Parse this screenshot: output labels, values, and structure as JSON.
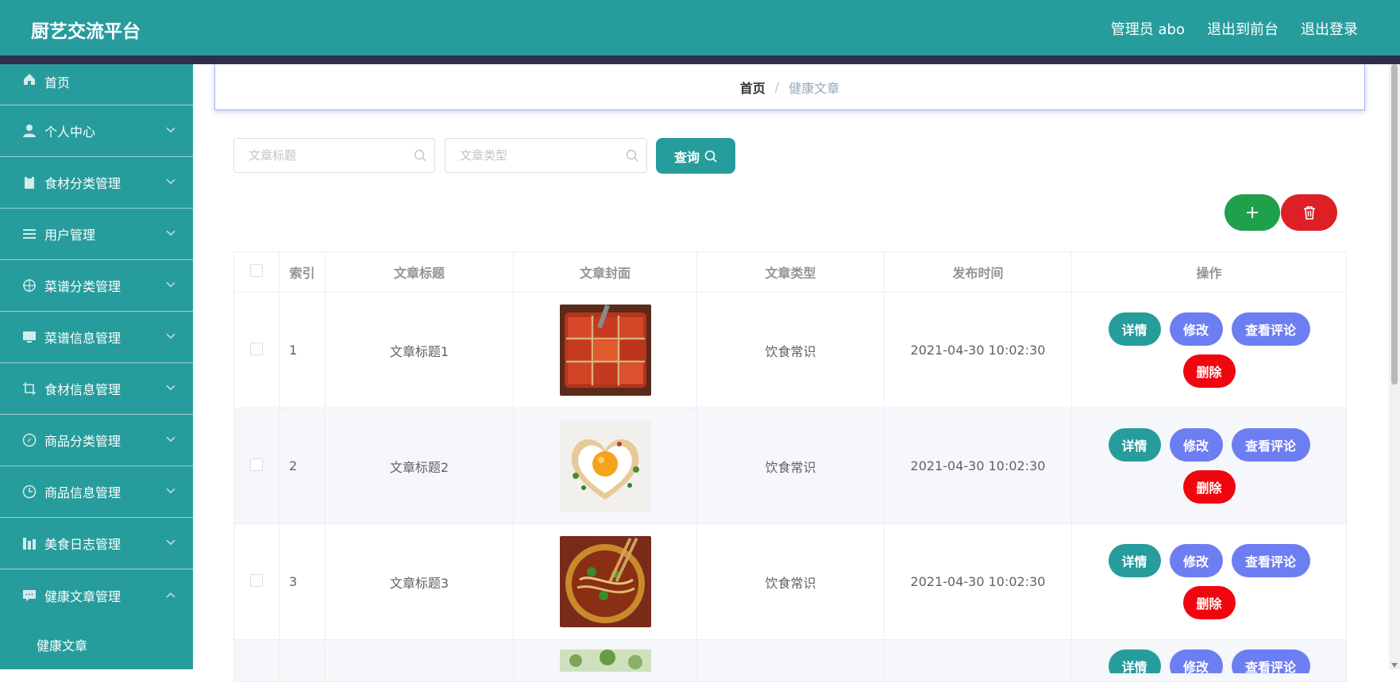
{
  "header": {
    "brand": "厨艺交流平台",
    "admin": "管理员 abo",
    "to_front": "退出到前台",
    "logout": "退出登录"
  },
  "sidebar": {
    "items": [
      {
        "label": "首页",
        "icon": "home-icon"
      },
      {
        "label": "个人中心",
        "icon": "user-icon"
      },
      {
        "label": "食材分类管理",
        "icon": "clipboard-icon"
      },
      {
        "label": "用户管理",
        "icon": "list-icon"
      },
      {
        "label": "菜谱分类管理",
        "icon": "target-icon"
      },
      {
        "label": "菜谱信息管理",
        "icon": "monitor-icon"
      },
      {
        "label": "食材信息管理",
        "icon": "crop-icon"
      },
      {
        "label": "商品分类管理",
        "icon": "compass-icon"
      },
      {
        "label": "商品信息管理",
        "icon": "clock-icon"
      },
      {
        "label": "美食日志管理",
        "icon": "chart-icon"
      },
      {
        "label": "健康文章管理",
        "icon": "chat-icon"
      }
    ],
    "sub_item": "健康文章"
  },
  "breadcrumb": {
    "home": "首页",
    "separator": "/",
    "current": "健康文章"
  },
  "search": {
    "title_placeholder": "文章标题",
    "type_placeholder": "文章类型",
    "query_label": "查询"
  },
  "table": {
    "columns": [
      "索引",
      "文章标题",
      "文章封面",
      "文章类型",
      "发布时间",
      "操作"
    ],
    "rows": [
      {
        "index": "1",
        "title": "文章标题1",
        "type": "饮食常识",
        "time": "2021-04-30 10:02:30",
        "cover": "hotpot-image"
      },
      {
        "index": "2",
        "title": "文章标题2",
        "type": "饮食常识",
        "time": "2021-04-30 10:02:30",
        "cover": "heart-egg-image"
      },
      {
        "index": "3",
        "title": "文章标题3",
        "type": "饮食常识",
        "time": "2021-04-30 10:02:30",
        "cover": "noodle-bowl-image"
      }
    ],
    "actions": {
      "detail": "详情",
      "edit": "修改",
      "comments": "查看评论",
      "delete": "删除"
    }
  },
  "colors": {
    "teal": "#279c9d",
    "header_bar": "#2f2f4a",
    "indigo": "#6d7ef2",
    "red": "#f0060f",
    "green": "#1fa04b"
  }
}
